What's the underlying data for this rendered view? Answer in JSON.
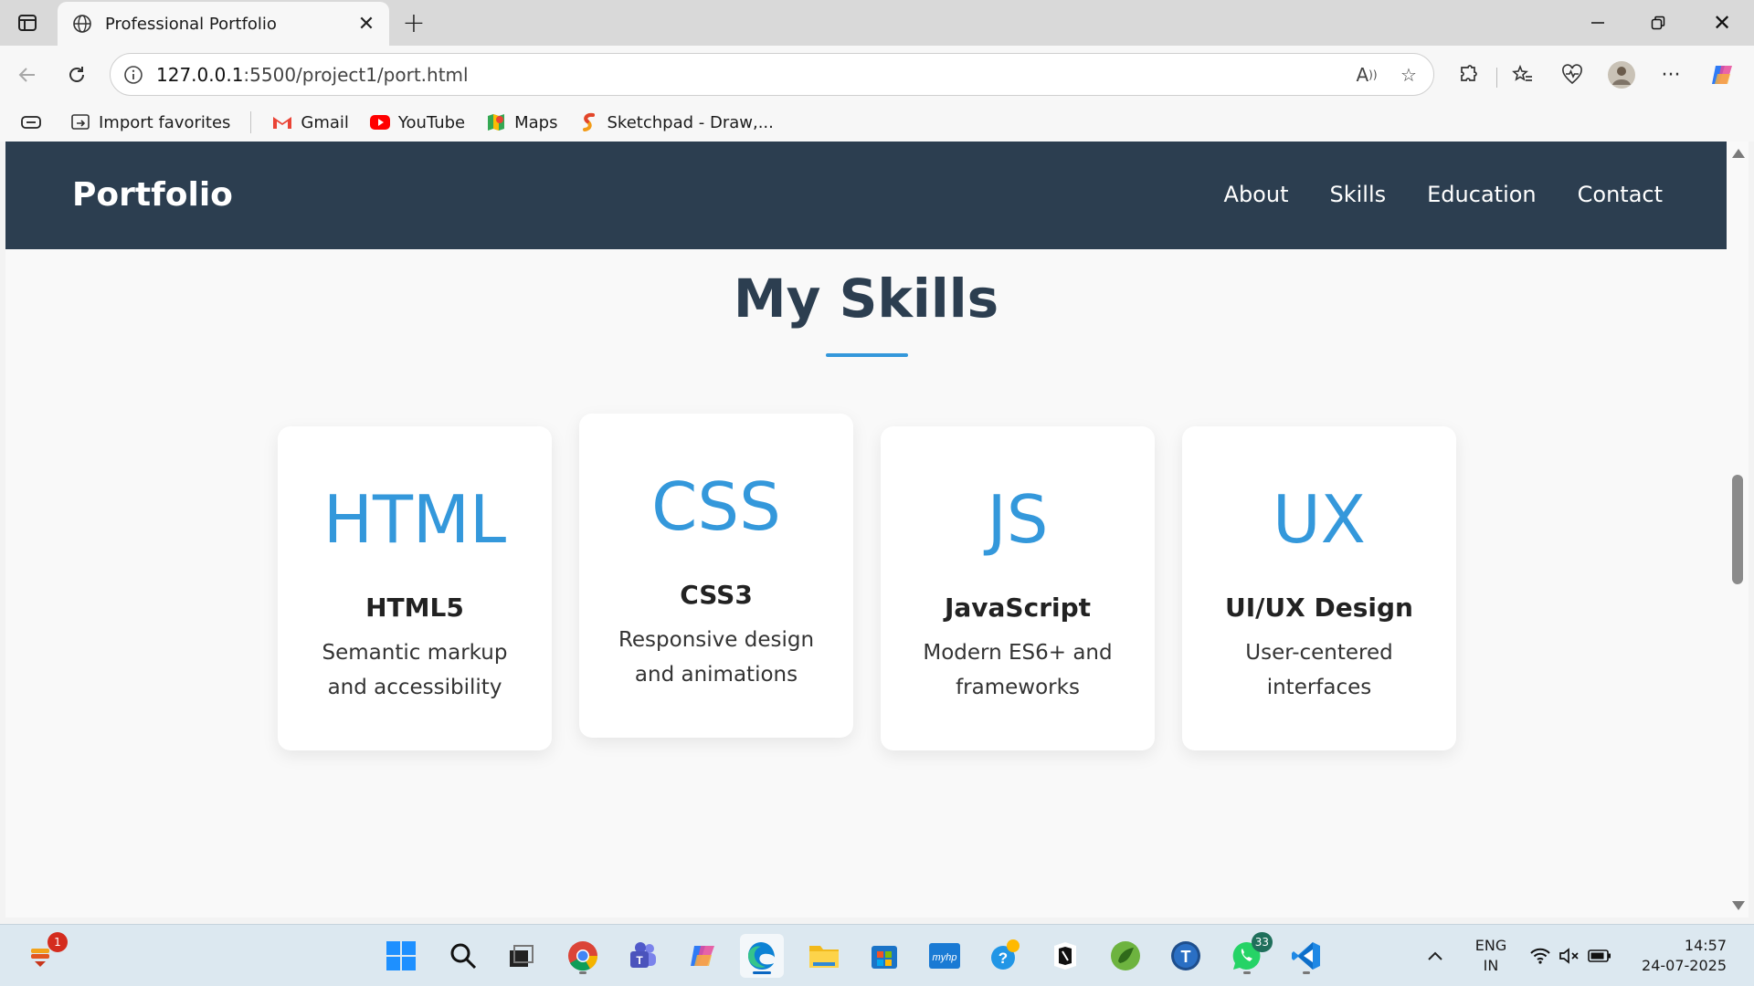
{
  "browser": {
    "tab_title": "Professional Portfolio",
    "url_host": "127.0.0.1",
    "url_rest": ":5500/project1/port.html",
    "bookmarks": [
      {
        "label": "Import favorites",
        "icon": "import-icon"
      },
      {
        "label": "Gmail",
        "icon": "gmail-icon"
      },
      {
        "label": "YouTube",
        "icon": "youtube-icon"
      },
      {
        "label": "Maps",
        "icon": "maps-icon"
      },
      {
        "label": "Sketchpad - Draw,...",
        "icon": "sketchpad-icon"
      }
    ]
  },
  "site": {
    "brand": "Portfolio",
    "nav": [
      "About",
      "Skills",
      "Education",
      "Contact"
    ],
    "section_title": "My Skills",
    "accent_color": "#3498db",
    "nav_bg_color": "#2c3e50",
    "skills": [
      {
        "abbr": "HTML",
        "name": "HTML5",
        "desc": "Semantic markup and accessibility"
      },
      {
        "abbr": "CSS",
        "name": "CSS3",
        "desc": "Responsive design and animations"
      },
      {
        "abbr": "JS",
        "name": "JavaScript",
        "desc": "Modern ES6+ and frameworks"
      },
      {
        "abbr": "UX",
        "name": "UI/UX Design",
        "desc": "User-centered interfaces"
      }
    ]
  },
  "taskbar": {
    "widgets_badge": "1",
    "whatsapp_badge": "33",
    "lang_line1": "ENG",
    "lang_line2": "IN",
    "time": "14:57",
    "date": "24-07-2025"
  }
}
